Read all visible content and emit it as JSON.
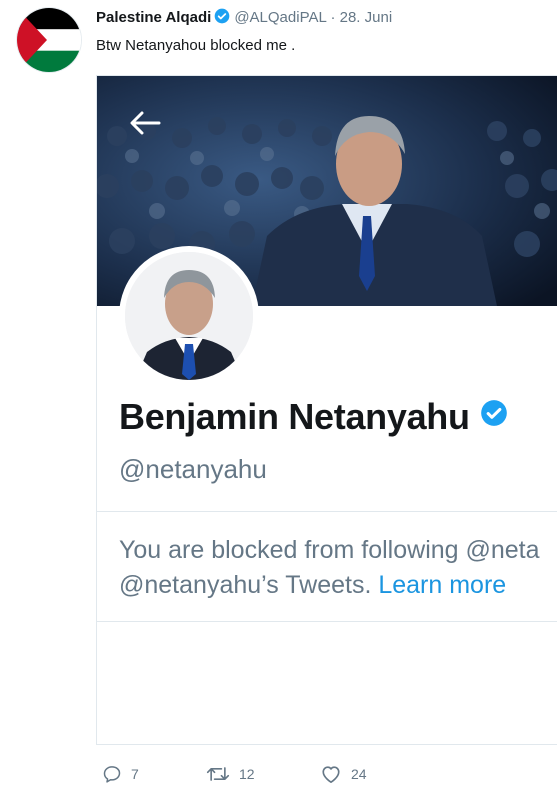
{
  "tweet": {
    "author_name": "Palestine Alqadi",
    "handle": "@ALQadiPAL",
    "separator": "·",
    "date": "28. Juni",
    "text": "Btw Netanyahou blocked me ."
  },
  "screenshot": {
    "display_name": "Benjamin Netanyahu",
    "handle": "@netanyahu",
    "blocked_line1": "You are blocked from following @neta",
    "blocked_line2_prefix": "@netanyahu’s Tweets. ",
    "learn_more": "Learn more"
  },
  "actions": {
    "replies": "7",
    "retweets": "12",
    "likes": "24"
  },
  "colors": {
    "verified": "#1da1f2",
    "link": "#1b95e0",
    "muted": "#657786",
    "text": "#14171a",
    "flag_red": "#ce1126",
    "flag_green": "#007a3d"
  },
  "icons": {
    "reply": "reply-icon",
    "retweet": "retweet-icon",
    "like": "heart-icon",
    "back": "back-arrow-icon",
    "verified": "verified-badge-icon"
  }
}
